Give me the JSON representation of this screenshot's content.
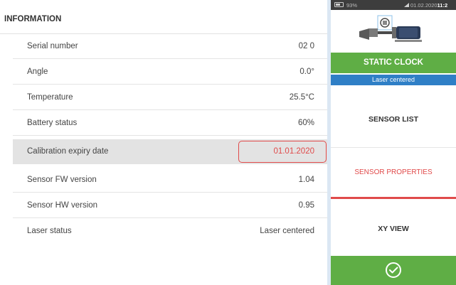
{
  "info": {
    "title": "INFORMATION",
    "rows": [
      {
        "label": "Serial number",
        "value": "02 0"
      },
      {
        "label": "Angle",
        "value": "0.0°"
      },
      {
        "label": "Temperature",
        "value": "25.5°C"
      },
      {
        "label": "Battery status",
        "value": "60%"
      },
      {
        "label": "Calibration expiry date",
        "value": "01.01.2020"
      },
      {
        "label": "Sensor FW version",
        "value": "1.04"
      },
      {
        "label": "Sensor HW version",
        "value": "0.95"
      },
      {
        "label": "Laser status",
        "value": "Laser centered"
      }
    ]
  },
  "status_bar": {
    "battery": "93%",
    "date": "01.02.2020",
    "time": "11:2"
  },
  "sidebar": {
    "static_clock": "STATIC CLOCK",
    "laser_status": "Laser centered",
    "sensor_list": "SENSOR LIST",
    "sensor_properties": "SENSOR PROPERTIES",
    "xy_view": "XY VIEW"
  },
  "colors": {
    "accent_green": "#5fae45",
    "accent_blue": "#2f7fc6",
    "highlight_red": "#e04a4a"
  },
  "icons": [
    "battery-icon",
    "signal-icon",
    "machine-train-icon",
    "check-circle-icon"
  ]
}
